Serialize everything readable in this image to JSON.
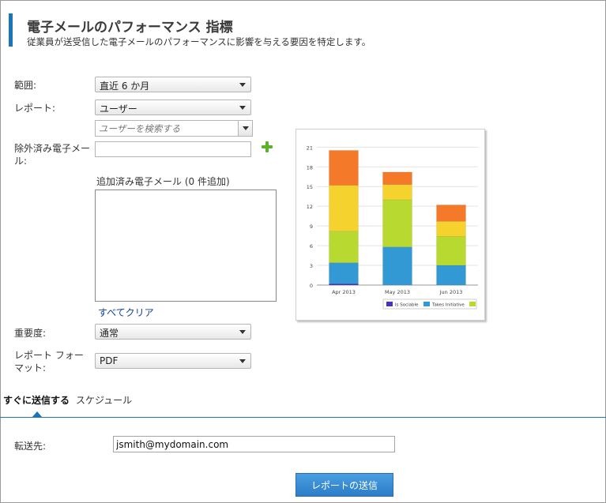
{
  "header": {
    "title": "電子メールのパフォーマンス 指標",
    "subtitle": "従業員が送受信した電子メールのパフォーマンスに影響を与える要因を特定します。"
  },
  "form": {
    "range_label": "範囲:",
    "range_value": "直近 6 か月",
    "report_label": "レポート:",
    "report_value": "ユーザー",
    "user_search_placeholder": "ユーザーを検索する",
    "excluded_label": "除外済み電子メール:",
    "added_emails_label": "追加済み電子メール (0 件追加)",
    "clear_all": "すべてクリア",
    "importance_label": "重要度:",
    "importance_value": "通常",
    "format_label": "レポート フォーマット:",
    "format_value": "PDF"
  },
  "tabs": {
    "send_now": "すぐに送信する",
    "schedule": "スケジュール"
  },
  "delivery": {
    "forward_label": "転送先:",
    "forward_value": "jsmith@mydomain.com",
    "send_button": "レポートの送信"
  },
  "colors": {
    "accent": "#1b75bb",
    "orange": "#f47a2a",
    "yellow": "#f5d22e",
    "green": "#b8d930",
    "blue": "#3399d4",
    "purple": "#4b2fbf"
  },
  "chart_data": {
    "type": "bar",
    "stacked": true,
    "categories": [
      "Apr 2013",
      "May 2013",
      "Jun 2013"
    ],
    "series": [
      {
        "name": "",
        "color": "#4b2fbf",
        "values": [
          0.2,
          0,
          0
        ]
      },
      {
        "name": "",
        "color": "#3399d4",
        "values": [
          3.2,
          5.8,
          3.0
        ]
      },
      {
        "name": "",
        "color": "#b8d930",
        "values": [
          4.8,
          7.2,
          4.4
        ]
      },
      {
        "name": "",
        "color": "#f5d22e",
        "values": [
          7.0,
          2.3,
          2.3
        ]
      },
      {
        "name": "",
        "color": "#f47a2a",
        "values": [
          5.3,
          1.9,
          2.5
        ]
      }
    ],
    "legend": [
      {
        "label": "Is Sociable",
        "color": "#4b2fbf"
      },
      {
        "label": "Takes Initiative",
        "color": "#3399d4"
      },
      {
        "label": "",
        "color": "#b8d930"
      }
    ],
    "yticks": [
      0,
      3,
      6,
      9,
      12,
      15,
      18,
      21
    ],
    "ylim": [
      0,
      22
    ],
    "grid": true,
    "legend_position": "bottom"
  }
}
